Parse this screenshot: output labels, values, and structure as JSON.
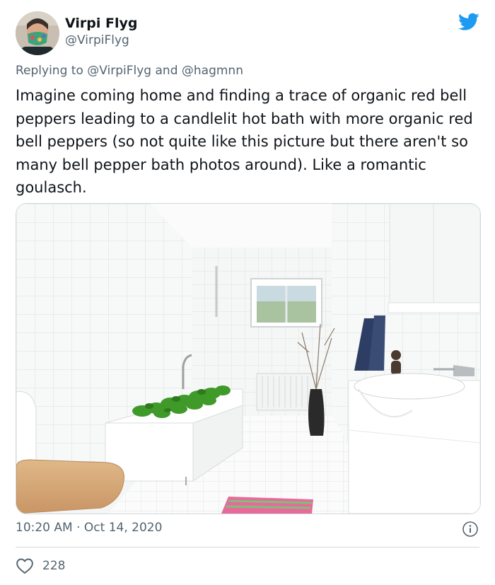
{
  "user": {
    "name": "Virpi Flyg",
    "handle": "@VirpiFlyg"
  },
  "reply": {
    "prefix": "Replying to",
    "mention1": "@VirpiFlyg",
    "joiner": "and",
    "mention2": "@hagmnn"
  },
  "tweet": {
    "text": "Imagine coming home and finding a trace of organic red bell peppers leading to a candlelit hot bath with more organic red bell peppers (so not quite like this picture but there aren't so many bell pepper bath photos around). Like a romantic goulasch."
  },
  "meta": {
    "time": "10:20 AM",
    "separator": "·",
    "date": "Oct 14, 2020"
  },
  "stats": {
    "likes": "228"
  },
  "icons": {
    "platform": "twitter-bird-icon",
    "info": "info-icon",
    "like": "heart-icon"
  },
  "colors": {
    "accent": "#1d9bf0",
    "secondary_text": "#536471",
    "divider": "#cfd9de"
  }
}
